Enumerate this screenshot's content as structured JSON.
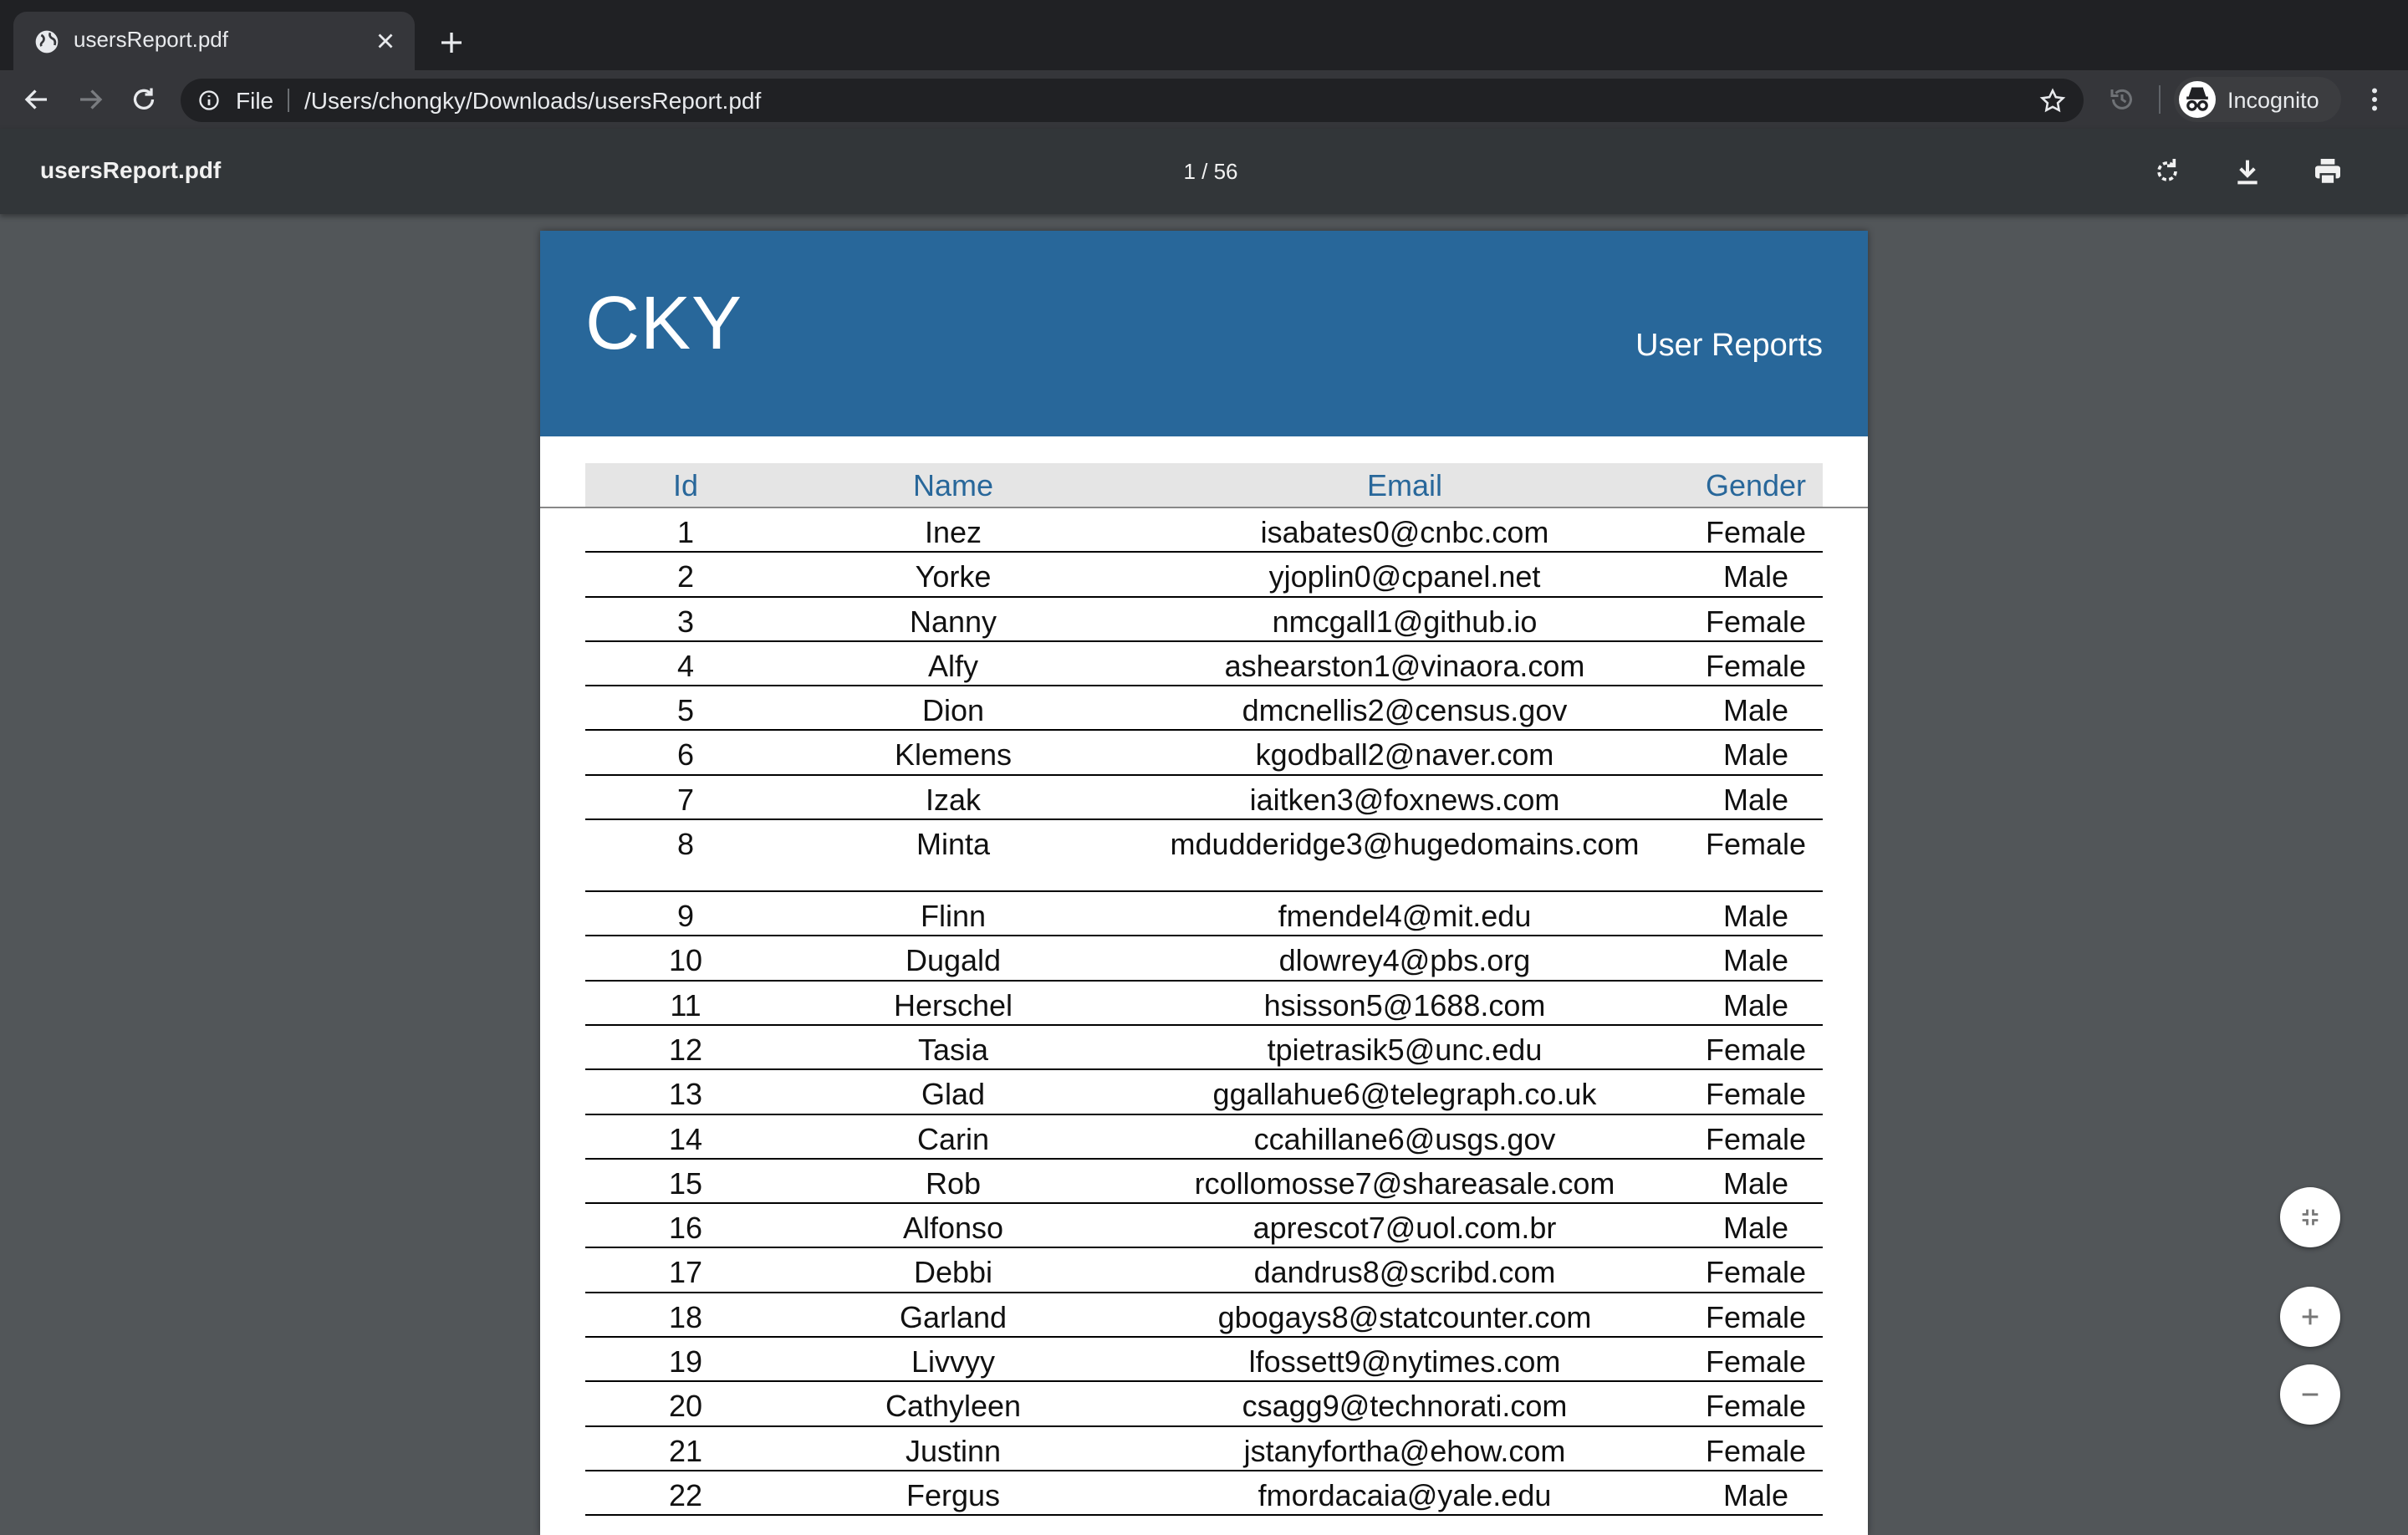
{
  "browser": {
    "tab": {
      "title": "usersReport.pdf",
      "favicon": "globe-icon"
    },
    "omnibox": {
      "scheme_label": "File",
      "url": "/Users/chongky/Downloads/usersReport.pdf"
    },
    "profile": {
      "label": "Incognito"
    }
  },
  "pdf_viewer": {
    "title": "usersReport.pdf",
    "page_indicator": "1 / 56"
  },
  "document": {
    "brand": "CKY",
    "report_title": "User Reports",
    "header_color": "#28679a",
    "columns": [
      "Id",
      "Name",
      "Email",
      "Gender"
    ],
    "rows": [
      [
        "1",
        "Inez",
        "isabates0@cnbc.com",
        "Female"
      ],
      [
        "2",
        "Yorke",
        "yjoplin0@cpanel.net",
        "Male"
      ],
      [
        "3",
        "Nanny",
        "nmcgall1@github.io",
        "Female"
      ],
      [
        "4",
        "Alfy",
        "ashearston1@vinaora.com",
        "Female"
      ],
      [
        "5",
        "Dion",
        "dmcnellis2@census.gov",
        "Male"
      ],
      [
        "6",
        "Klemens",
        "kgodball2@naver.com",
        "Male"
      ],
      [
        "7",
        "Izak",
        "iaitken3@foxnews.com",
        "Male"
      ],
      [
        "8",
        "Minta",
        "mdudderidge3@hugedomains.com",
        "Female"
      ],
      [
        "9",
        "Flinn",
        "fmendel4@mit.edu",
        "Male"
      ],
      [
        "10",
        "Dugald",
        "dlowrey4@pbs.org",
        "Male"
      ],
      [
        "11",
        "Herschel",
        "hsisson5@1688.com",
        "Male"
      ],
      [
        "12",
        "Tasia",
        "tpietrasik5@unc.edu",
        "Female"
      ],
      [
        "13",
        "Glad",
        "ggallahue6@telegraph.co.uk",
        "Female"
      ],
      [
        "14",
        "Carin",
        "ccahillane6@usgs.gov",
        "Female"
      ],
      [
        "15",
        "Rob",
        "rcollomosse7@shareasale.com",
        "Male"
      ],
      [
        "16",
        "Alfonso",
        "aprescot7@uol.com.br",
        "Male"
      ],
      [
        "17",
        "Debbi",
        "dandrus8@scribd.com",
        "Female"
      ],
      [
        "18",
        "Garland",
        "gbogays8@statcounter.com",
        "Female"
      ],
      [
        "19",
        "Livvyy",
        "lfossett9@nytimes.com",
        "Female"
      ],
      [
        "20",
        "Cathyleen",
        "csagg9@technorati.com",
        "Female"
      ],
      [
        "21",
        "Justinn",
        "jstanyfortha@ehow.com",
        "Female"
      ],
      [
        "22",
        "Fergus",
        "fmordacaia@yale.edu",
        "Male"
      ]
    ]
  }
}
